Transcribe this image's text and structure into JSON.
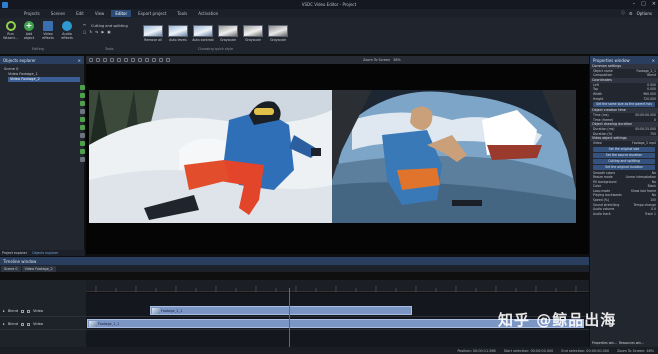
{
  "window": {
    "title": "VSDC Video Editor - Project"
  },
  "menu": {
    "items": [
      "Projects",
      "Scenes",
      "Edit",
      "View",
      "Editor",
      "Export project",
      "Tools",
      "Activation"
    ],
    "active_index": 4,
    "user": "Options"
  },
  "ribbon": {
    "buttons": [
      "Run Wizard...",
      "Add object",
      "Video effects",
      "Audio effects"
    ],
    "editing_group": "Editing",
    "tools": [
      "Cutting and splitting"
    ],
    "tool_group": "Tools",
    "effects": [
      "Remove all",
      "Auto levels",
      "Auto contrast",
      "Grayscale",
      "Grayscale",
      "Grayscale"
    ],
    "effects_group": "Choosing quick style"
  },
  "objects_explorer": {
    "title": "Objects explorer",
    "tree": [
      "Scene 0",
      "Video Footage_1",
      "Video Footage_2"
    ],
    "tabs": [
      "Project explorer",
      "Objects explorer"
    ]
  },
  "canvas_toolbar": {
    "zoom_label": "Zoom To Screen",
    "zoom_value": "38%"
  },
  "properties": {
    "title": "Properties window",
    "sections": [
      {
        "name": "Common settings",
        "rows": [
          [
            "Object name",
            "Footage_2_1"
          ],
          [
            "Composition",
            "Blend"
          ]
        ]
      },
      {
        "name": "Coordinates",
        "rows": [
          [
            "Left",
            "0.000"
          ],
          [
            "Top",
            "0.000"
          ],
          [
            "Width",
            "960.000"
          ],
          [
            "Height",
            "720.000"
          ]
        ]
      },
      {
        "name": "Object creation time",
        "rows": [
          [
            "Time (ms)",
            "00:00:00.000"
          ],
          [
            "Time (frame)",
            "0"
          ]
        ]
      },
      {
        "name": "Object drawing duration",
        "rows": [
          [
            "Duration (ms)",
            "00:00:25.000"
          ],
          [
            "Duration (fr)",
            "750"
          ]
        ]
      },
      {
        "name": "Video object settings",
        "rows": [
          [
            "Video",
            "Footage_2 mp4"
          ]
        ]
      }
    ],
    "buttons": [
      "Set the same size as the parent has",
      "Set the original size",
      "Set the source duration",
      "Cutting and splitting",
      "Set the original duration"
    ],
    "extra_rows": [
      [
        "Smooth colors",
        "No"
      ],
      [
        "Resize mode",
        "Linear interpolation"
      ],
      [
        "Fill background",
        "No"
      ],
      [
        "Color",
        "Black"
      ],
      [
        "Loop mode",
        "Show last frame"
      ],
      [
        "Playing backwards",
        "No"
      ],
      [
        "Speed (%)",
        "100"
      ],
      [
        "Sound stretching",
        "Tempo change"
      ],
      [
        "Audio volume",
        "0.0"
      ],
      [
        "Audio track",
        "Track 1"
      ]
    ],
    "bottom_tabs": [
      "Properties win...",
      "Resources win..."
    ]
  },
  "timeline": {
    "title": "Timeline window",
    "tabs": [
      "Scene 0",
      "Video Footage_2"
    ],
    "tracks": [
      {
        "blend": "Blend",
        "type": "Video",
        "clip": "Footage_2_1"
      },
      {
        "blend": "Blend",
        "type": "Video",
        "clip": "Footage_1_1"
      }
    ]
  },
  "status": {
    "position": "Position: 00:00:11.566",
    "start": "Start selection: 00:00:00.000",
    "end": "End selection: 00:00:00.000",
    "zoom": "Zoom To Screen: 46%"
  },
  "watermark": "知乎 @鲸品出海",
  "colors": {
    "accent": "#2b4a76",
    "header": "#2a3f5f",
    "clip": "#7b95c4",
    "playhead": "#e0342f"
  }
}
